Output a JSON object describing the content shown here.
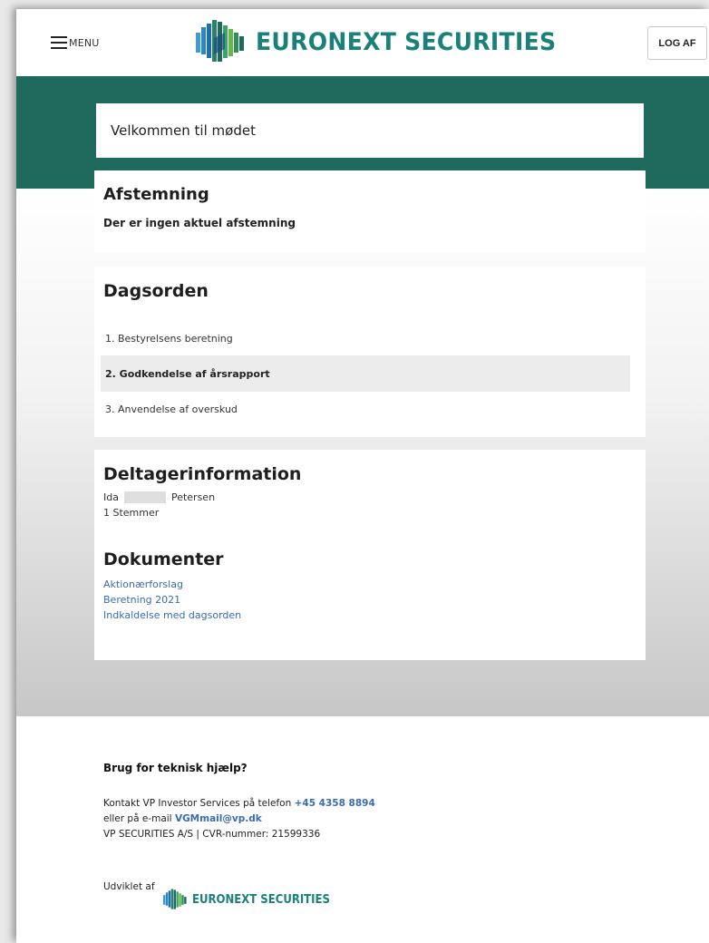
{
  "header": {
    "menu_label": "MENU",
    "logo_text": "EURONEXT SECURITIES",
    "logout_label": "LOG AF"
  },
  "welcome": {
    "text": "Velkommen til mødet"
  },
  "vote": {
    "title": "Afstemning",
    "message": "Der er ingen aktuel afstemning"
  },
  "agenda": {
    "title": "Dagsorden",
    "items": [
      {
        "label": "1. Bestyrelsens beretning"
      },
      {
        "label": "2. Godkendelse af årsrapport"
      },
      {
        "label": "3. Anvendelse af overskud"
      }
    ]
  },
  "participant": {
    "title": "Deltagerinformation",
    "first_name": "Ida",
    "last_name": "Petersen",
    "votes": "1 Stemmer"
  },
  "documents": {
    "title": "Dokumenter",
    "items": [
      {
        "label": "Aktionærforslag"
      },
      {
        "label": "Beretning 2021"
      },
      {
        "label": "Indkaldelse med dagsorden"
      }
    ]
  },
  "footer": {
    "help_title": "Brug for teknisk hjælp?",
    "contact_prefix": "Kontakt VP Investor Services på telefon",
    "phone": "+45 4358 8894",
    "email_prefix": "eller på e-mail",
    "email": "VGMmail@vp.dk",
    "company_line": "VP SECURITIES A/S | CVR-nummer: 21599336",
    "developed_by": "Udviklet af",
    "logo_text": "EURONEXT SECURITIES"
  },
  "colors": {
    "brand_teal": "#1a8079",
    "band_green": "#1f6a5c",
    "link_blue": "#3b6bb0"
  }
}
